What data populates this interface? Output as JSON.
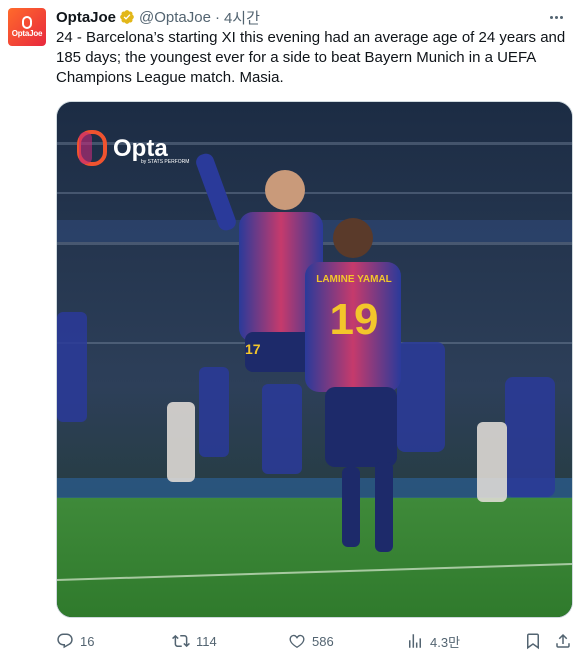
{
  "account": {
    "display_name": "OptaJoe",
    "handle": "@OptaJoe",
    "timestamp": "4시간",
    "avatar_text": "OptaJoe",
    "verified": true,
    "brand_color": "#f0532f"
  },
  "tweet": {
    "text": "24 - Barcelona’s starting XI this evening had an average age of 24 years and 185 days; the youngest ever for a side to beat Bayern Munich in a UEFA Champions League match. Masia."
  },
  "media": {
    "logo_text": "Opta",
    "logo_subtext": "by STATS PERFORM",
    "shirt_name": "LAMINE YAMAL",
    "shirt_number": "19",
    "other_number": "17"
  },
  "actions": {
    "replies": "16",
    "reposts": "114",
    "likes": "586",
    "views": "4.3만"
  },
  "colors": {
    "text": "#0f1419",
    "secondary": "#536471",
    "verified": "#e2b719"
  },
  "icons": [
    "verified-badge-icon",
    "more-icon",
    "reply-icon",
    "repost-icon",
    "like-icon",
    "views-icon",
    "bookmark-icon",
    "share-icon"
  ]
}
